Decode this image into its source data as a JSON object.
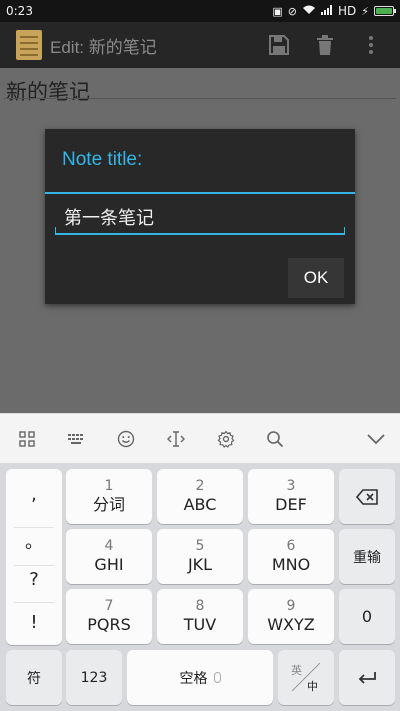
{
  "status_bar": {
    "time": "0:23",
    "network": "HD"
  },
  "action_bar": {
    "title": "Edit: 新的笔记"
  },
  "note": {
    "title": "新的笔记"
  },
  "dialog": {
    "title": "Note title:",
    "input_value": "第一条笔记",
    "ok_label": "OK"
  },
  "keyboard": {
    "symbols": [
      ",",
      "。",
      "?",
      "!"
    ],
    "keys": [
      {
        "num": "1",
        "label": "分词"
      },
      {
        "num": "2",
        "label": "ABC"
      },
      {
        "num": "3",
        "label": "DEF"
      },
      {
        "num": "4",
        "label": "GHI"
      },
      {
        "num": "5",
        "label": "JKL"
      },
      {
        "num": "6",
        "label": "MNO"
      },
      {
        "num": "7",
        "label": "PQRS"
      },
      {
        "num": "8",
        "label": "TUV"
      },
      {
        "num": "9",
        "label": "WXYZ"
      }
    ],
    "reenter_label": "重输",
    "zero_label": "0",
    "symbol_label": "符",
    "numbers_label": "123",
    "space_label": "空格",
    "lang_top": "英",
    "lang_bottom": "中"
  }
}
